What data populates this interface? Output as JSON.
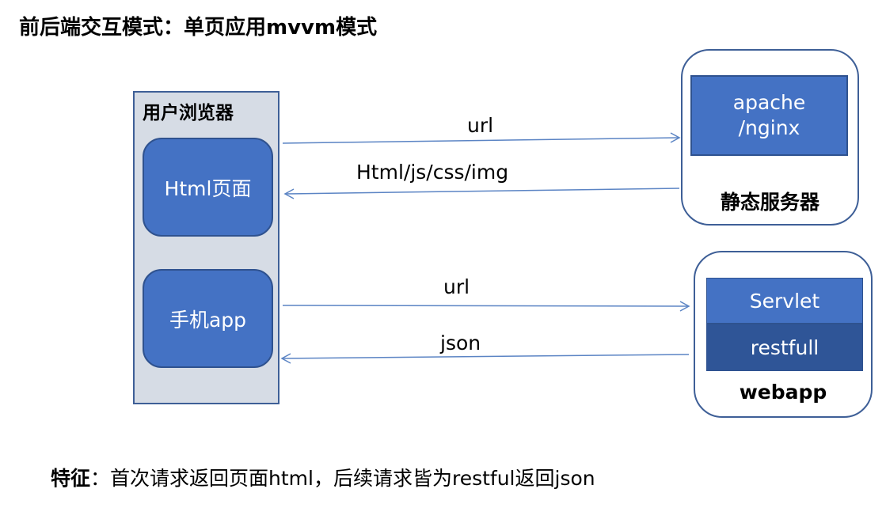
{
  "title": "前后端交互模式：单页应用mvvm模式",
  "browser": {
    "label": "用户浏览器",
    "html_page": "Html页面",
    "mobile_app": "手机app"
  },
  "static_server": {
    "box_line1": "apache",
    "box_line2": "/nginx",
    "label": "静态服务器"
  },
  "webapp_server": {
    "servlet": "Servlet",
    "restfull": "restfull",
    "label": "webapp"
  },
  "arrows": {
    "url_to_static": "url",
    "static_to_browser": "Html/js/css/img",
    "url_to_webapp": "url",
    "webapp_to_app": "json"
  },
  "feature": {
    "key": "特征",
    "text": "：首次请求返回页面html，后续请求皆为restful返回json"
  },
  "colors": {
    "box_fill": "#4472c4",
    "box_dark_fill": "#2f5597",
    "container_fill": "#d6dce5",
    "border": "#3e5f97",
    "arrow": "#5b84c4"
  }
}
